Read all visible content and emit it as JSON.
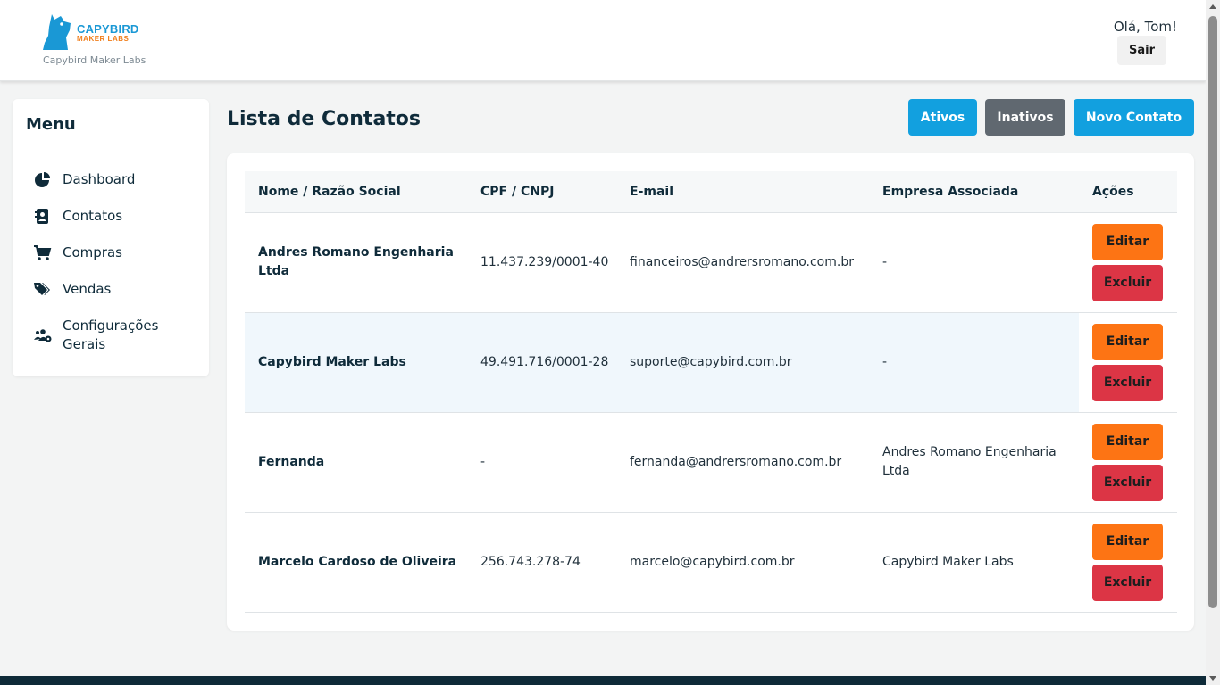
{
  "brand": {
    "logo_line1": "CAPYBIRD",
    "logo_line2": "MAKER LABS",
    "caption": "Capybird Maker Labs",
    "primary_color": "#1a98d5",
    "secondary_color": "#f07d1a"
  },
  "header": {
    "greeting": "Olá, Tom!",
    "logout_label": "Sair"
  },
  "sidebar": {
    "title": "Menu",
    "items": [
      {
        "label": "Dashboard",
        "icon": "pie-chart-icon"
      },
      {
        "label": "Contatos",
        "icon": "address-book-icon"
      },
      {
        "label": "Compras",
        "icon": "shopping-cart-icon"
      },
      {
        "label": "Vendas",
        "icon": "tags-icon"
      },
      {
        "label": "Configurações Gerais",
        "icon": "users-gear-icon"
      }
    ]
  },
  "main": {
    "title": "Lista de Contatos",
    "buttons": {
      "active": "Ativos",
      "inactive": "Inativos",
      "new_contact": "Novo Contato"
    },
    "table": {
      "columns": [
        "Nome / Razão Social",
        "CPF / CNPJ",
        "E-mail",
        "Empresa Associada",
        "Ações"
      ],
      "rows": [
        {
          "name": "Andres Romano Engenharia Ltda",
          "document": "11.437.239/0001-40",
          "email": "financeiros@andrersromano.com.br",
          "company": "-"
        },
        {
          "name": "Capybird Maker Labs",
          "document": "49.491.716/0001-28",
          "email": "suporte@capybird.com.br",
          "company": "-"
        },
        {
          "name": "Fernanda",
          "document": "-",
          "email": "fernanda@andrersromano.com.br",
          "company": "Andres Romano Engenharia Ltda"
        },
        {
          "name": "Marcelo Cardoso de Oliveira",
          "document": "256.743.278-74",
          "email": "marcelo@capybird.com.br",
          "company": "Capybird Maker Labs"
        }
      ],
      "edit_label": "Editar",
      "delete_label": "Excluir"
    }
  },
  "colors": {
    "accent_blue": "#12a0df",
    "inactive_gray": "#606870",
    "edit_orange": "#fd7414",
    "delete_red": "#dc3545",
    "footer_dark": "#0e2a38"
  }
}
